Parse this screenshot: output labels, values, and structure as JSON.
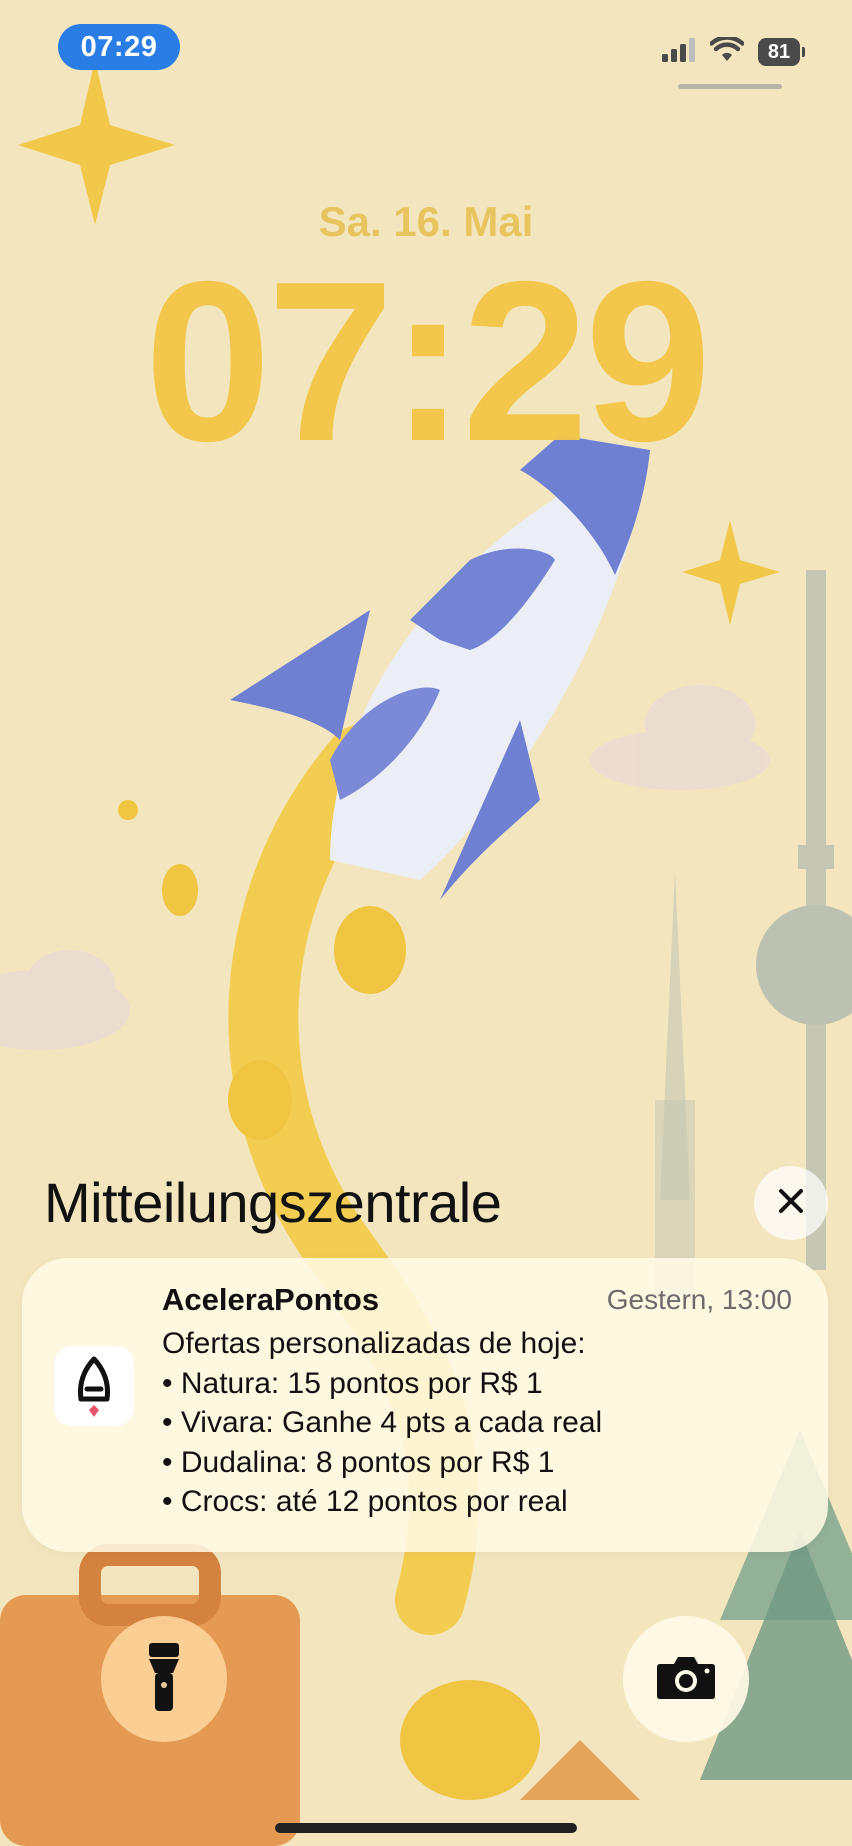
{
  "status_bar": {
    "time": "07:29",
    "battery": "81",
    "icons": [
      "cellular-signal-icon",
      "wifi-icon",
      "battery-icon"
    ]
  },
  "lock_screen": {
    "date": "Sa. 16. Mai",
    "time": "07:29"
  },
  "notification_center": {
    "title": "Mitteilungszentrale",
    "close_icon": "close-icon",
    "notifications": [
      {
        "app": "AceleraPontos",
        "time": "Gestern, 13:00",
        "lines": [
          "Ofertas personalizadas de hoje:",
          "• Natura: 15 pontos por R$ 1",
          "• Vivara: Ganhe 4 pts a cada real",
          "• Dudalina: 8 pontos por R$ 1",
          "• Crocs: até 12 pontos por real"
        ]
      }
    ]
  },
  "controls": {
    "left": "flashlight-icon",
    "right": "camera-icon"
  },
  "colors": {
    "accent_time_pill": "#2b7de6",
    "clock": "#f4c646",
    "wallpaper": "#f3e6bf"
  }
}
